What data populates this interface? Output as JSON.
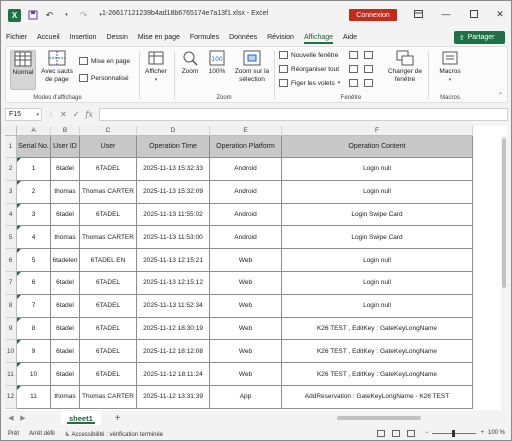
{
  "window": {
    "title": "1-26617121239b4ad18b6765174e7a13f1.xlsx  -  Excel",
    "signin_label": "Connexion"
  },
  "ribbon_tabs": [
    "Fichier",
    "Accueil",
    "Insertion",
    "Dessin",
    "Mise en page",
    "Formules",
    "Données",
    "Révision",
    "Affichage",
    "Aide"
  ],
  "active_tab": "Affichage",
  "share_label": "Partager",
  "ribbon": {
    "workbook_views": {
      "normal": "Normal",
      "page_break": "Avec sauts de page",
      "page_layout": "Mise en page",
      "custom": "Personnalisé",
      "group_label": "Modes d'affichage"
    },
    "show": {
      "label": "Afficher"
    },
    "zoom": {
      "zoom": "Zoom",
      "hundred": "100%",
      "selection": "Zoom sur la sélection",
      "group_label": "Zoom"
    },
    "window": {
      "new_window": "Nouvelle fenêtre",
      "arrange_all": "Réorganiser tout",
      "freeze": "Figer les volets",
      "switch": "Changer de fenêtre",
      "group_label": "Fenêtre"
    },
    "macros": {
      "label": "Macros",
      "group_label": "Macros"
    }
  },
  "formula_bar": {
    "name_box": "F15",
    "fx": "fx",
    "value": ""
  },
  "columns": [
    "A",
    "B",
    "C",
    "D",
    "E",
    "F"
  ],
  "rows_numbers": [
    "1",
    "2",
    "3",
    "4",
    "5",
    "6",
    "7",
    "8",
    "9",
    "10",
    "11",
    "12"
  ],
  "table": {
    "headers": [
      "Serial No.",
      "User ID",
      "User",
      "Operation Time",
      "Operation Platform",
      "Operation Content"
    ],
    "rows": [
      [
        "1",
        "6tadel",
        "6TADEL",
        "2025-11-13 15:32:33",
        "Android",
        "Login null"
      ],
      [
        "2",
        "thomas",
        "Thomas CARTER",
        "2025-11-13 15:32:09",
        "Android",
        "Login null"
      ],
      [
        "3",
        "6tadel",
        "6TADEL",
        "2025-11-13 11:55:02",
        "Android",
        "Login Swipe Card"
      ],
      [
        "4",
        "thomas",
        "Thomas CARTER",
        "2025-11-13 11:53:00",
        "Android",
        "Login Swipe Card"
      ],
      [
        "5",
        "6tadelen",
        "6TADEL EN",
        "2025-11-13 12:15:21",
        "Web",
        "Login null"
      ],
      [
        "6",
        "6tadel",
        "6TADEL",
        "2025-11-13 12:15:12",
        "Web",
        "Login null"
      ],
      [
        "7",
        "6tadel",
        "6TADEL",
        "2025-11-13 11:52:34",
        "Web",
        "Login null"
      ],
      [
        "8",
        "6tadel",
        "6TADEL",
        "2025-11-12 18:30:19",
        "Web",
        "K26 TEST , EditKey : GateKeyLongName"
      ],
      [
        "9",
        "6tadel",
        "6TADEL",
        "2025-11-12 18:12:08",
        "Web",
        "K26 TEST , EditKey : GateKeyLongName"
      ],
      [
        "10",
        "6tadel",
        "6TADEL",
        "2025-11-12 18:11:24",
        "Web",
        "K26 TEST , EditKey : GateKeyLongName"
      ],
      [
        "11",
        "thomas",
        "Thomas CARTER",
        "2025-11-12 13:31:39",
        "App",
        "AddReservation : GateKeyLongName - K26 TEST"
      ]
    ]
  },
  "sheet_tab": "sheet1",
  "status": {
    "ready": "Prêt",
    "scroll": "Arrêt défil",
    "accessibility": "Accessibilité : vérification terminée",
    "zoom_level": "100 %"
  }
}
